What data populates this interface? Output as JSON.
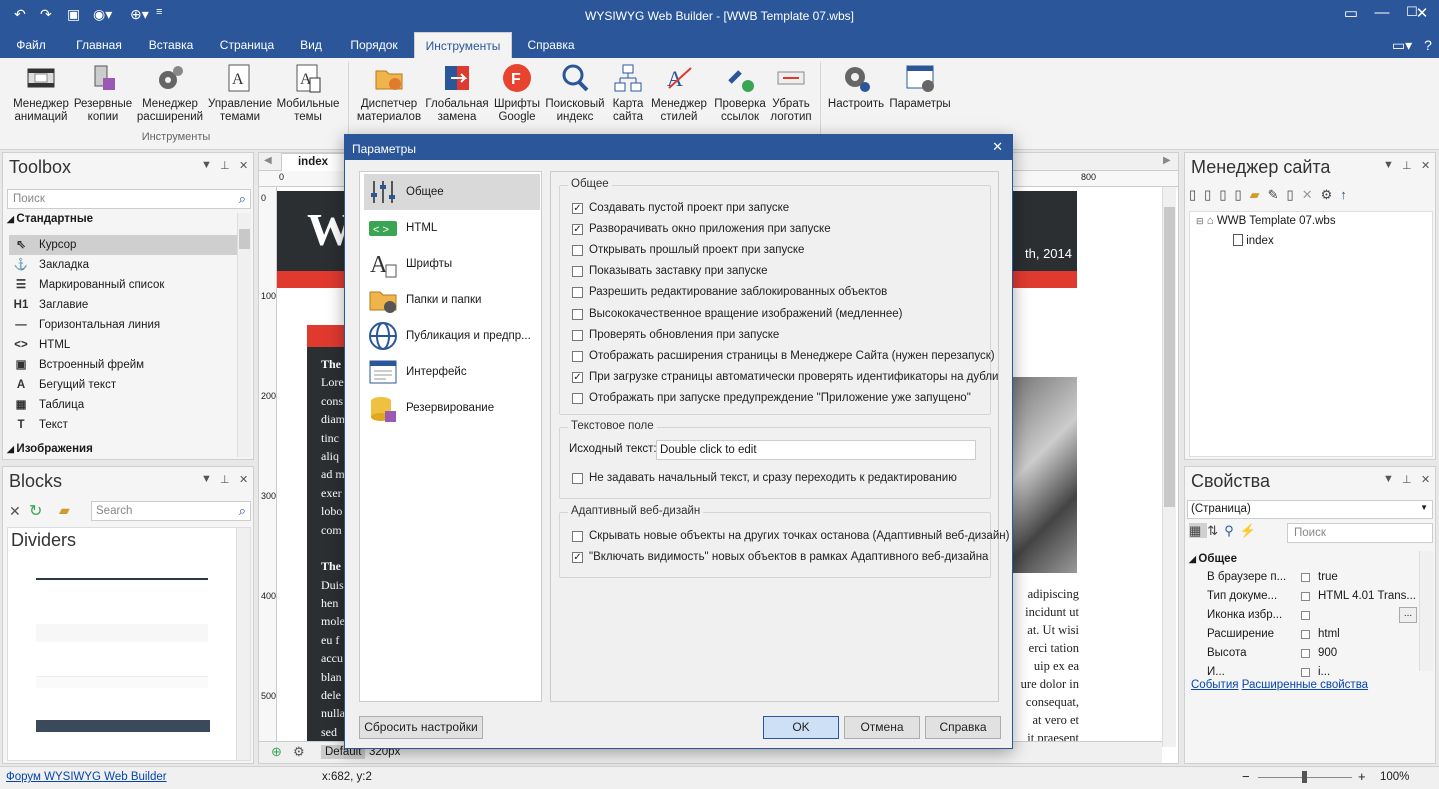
{
  "app": {
    "title": "WYSIWYG Web Builder - [WWB Template 07.wbs]"
  },
  "menu": [
    "Файл",
    "Главная",
    "Вставка",
    "Страница",
    "Вид",
    "Порядок",
    "Инструменты",
    "Справка"
  ],
  "ribbon": {
    "group1": [
      "Менеджер анимаций",
      "Резервные копии",
      "Менеджер расширений",
      "Управление темами",
      "Мобильные темы"
    ],
    "group1_label": "Инструменты",
    "group2": [
      "Диспетчер материалов",
      "Глобальная замена",
      "Шрифты Google",
      "Поисковый индекс",
      "Карта сайта",
      "Менеджер стилей",
      "Проверка ссылок",
      "Убрать логотип"
    ],
    "group3": [
      "Настроить",
      "Параметры"
    ]
  },
  "toolbox": {
    "title": "Toolbox",
    "search_placeholder": "Поиск",
    "section1": "Стандартные",
    "items": [
      "Курсор",
      "Закладка",
      "Маркированный список",
      "Заглавие",
      "Горизонтальная линия",
      "HTML",
      "Встроенный фрейм",
      "Бегущий текст",
      "Таблица",
      "Текст"
    ],
    "icons": [
      "⇖",
      "⚓",
      "☰",
      "H1",
      "—",
      "<>",
      "▣",
      "A",
      "▦",
      "T"
    ],
    "section2": "Изображения"
  },
  "blocks": {
    "title": "Blocks",
    "search_placeholder": "Search",
    "category": "Dividers"
  },
  "editor": {
    "tab": "index",
    "ruler_marks": [
      "0",
      "100",
      "200",
      "300",
      "400",
      "500"
    ],
    "ruler_right": "800",
    "header_letter": "W",
    "date_text": "th, 2014",
    "left_texts": [
      "The",
      "Lore",
      "cons",
      "diam",
      "tinc",
      "aliq",
      "ad m",
      "exer",
      "lobo",
      "com",
      "",
      "The",
      "Duis",
      "hen",
      "mole",
      "eu f",
      "accu",
      "blan",
      "dele",
      "nulla",
      "sed"
    ],
    "right_texts": [
      "adipiscing",
      "incidunt ut",
      "at. Ut wisi",
      "erci tation",
      "uip ex ea",
      "ure dolor in",
      "consequat,",
      "at vero et",
      "it praesent"
    ],
    "breakpoint_default": "Default",
    "breakpoint_320": "320px"
  },
  "dialog": {
    "title": "Параметры",
    "nav": [
      "Общее",
      "HTML",
      "Шрифты",
      "Папки и папки",
      "Публикация и предпр...",
      "Интерфейс",
      "Резервирование"
    ],
    "general_title": "Общее",
    "general": [
      {
        "label": "Создавать пустой проект при запуске",
        "checked": true
      },
      {
        "label": "Разворачивать окно приложения при запуске",
        "checked": true
      },
      {
        "label": "Открывать прошлый проект при запуске",
        "checked": false
      },
      {
        "label": "Показывать заставку при запуске",
        "checked": false
      },
      {
        "label": "Разрешить редактирование заблокированных объектов",
        "checked": false
      },
      {
        "label": "Высококачественное вращение изображений (медленнее)",
        "checked": false
      },
      {
        "label": "Проверять обновления при запуске",
        "checked": false
      },
      {
        "label": "Отображать расширения страницы в Менеджере Сайта (нужен перезапуск)",
        "checked": false
      },
      {
        "label": "При загрузке страницы автоматически проверять идентификаторы на дубли",
        "checked": true
      },
      {
        "label": "Отображать при запуске предупреждение \"Приложение уже запущено\"",
        "checked": false
      }
    ],
    "textfield_title": "Текстовое поле",
    "source_label": "Исходный текст:",
    "source_value": "Double click to edit",
    "textfield_check": {
      "label": "Не задавать начальный текст, и сразу переходить к редактированию",
      "checked": false
    },
    "adaptive_title": "Адаптивный веб-дизайн",
    "adaptive": [
      {
        "label": "Скрывать новые объекты на других точках останова (Адаптивный веб-дизайн)",
        "checked": false
      },
      {
        "label": "\"Включать видимость\" новых объектов в рамках Адаптивного веб-дизайна",
        "checked": true
      }
    ],
    "reset_label": "Сбросить настройки",
    "ok_label": "OK",
    "cancel_label": "Отмена",
    "help_label": "Справка"
  },
  "site_manager": {
    "title": "Менеджер сайта",
    "root": "WWB Template 07.wbs",
    "page": "index"
  },
  "properties": {
    "title": "Свойства",
    "selector": "(Страница)",
    "search_placeholder": "Поиск",
    "section": "Общее",
    "rows": [
      {
        "name": "В браузере п...",
        "value": "true"
      },
      {
        "name": "Тип докуме...",
        "value": "HTML 4.01 Trans..."
      },
      {
        "name": "Иконка избр...",
        "value": ""
      },
      {
        "name": "Расширение",
        "value": "html"
      },
      {
        "name": "Высота",
        "value": "900"
      },
      {
        "name": "И...",
        "value": "i..."
      }
    ],
    "link_events": "События",
    "link_ext": "Расширенные свойства"
  },
  "status": {
    "forum": "Форум WYSIWYG Web Builder",
    "coords": "x:682, y:2",
    "zoom": "100%"
  },
  "colors": {
    "accent": "#2b579a",
    "red": "#e03a2f",
    "dark": "#2b2f31"
  }
}
